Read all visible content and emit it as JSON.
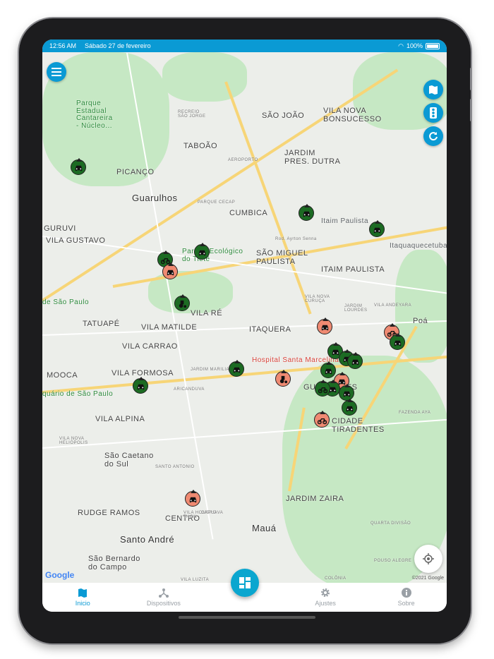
{
  "status_bar": {
    "time": "12:56 AM",
    "date": "Sábado 27 de fevereiro",
    "battery": "100%"
  },
  "map": {
    "labels": {
      "guarulhos": "Guarulhos",
      "cumbica": "CUMBICA",
      "taboao": "TABOÃO",
      "picanco": "PICANÇO",
      "sao_joao": "SÃO JOÃO",
      "vila_nova_bonsucesso": "VILA NOVA\nBONSUCESSO",
      "jardim_pres_dutra": "JARDIM\nPRES. DUTRA",
      "sao_miguel": "SÃO MIGUEL\nPAULISTA",
      "itaim_paulista": "ITAIM PAULISTA",
      "itaim_paulista_small": "Itaim Paulista",
      "itaquaquecetuba": "Itaquaquecetuba",
      "vila_re": "VILA RÉ",
      "vila_matilde": "VILA MATILDE",
      "tatuape": "TATUAPÉ",
      "vila_carrao": "VILA CARRAO",
      "mooca": "MOOCA",
      "vila_formosa": "VILA FORMOSA",
      "itaquera": "ITAQUERA",
      "hospital": "Hospital Santa Marcelina",
      "guaianases": "GUAIANASES",
      "cidade_tiradentes": "CIDADE\nTIRADENTES",
      "vila_alpina": "VILA ALPINA",
      "sao_caetano": "São Caetano\ndo Sul",
      "rudge_ramos": "RUDGE RAMOS",
      "centro": "CENTRO",
      "santo_andre": "Santo André",
      "sao_bernardo": "São Bernardo\ndo Campo",
      "jardim_zaira": "JARDIM ZAIRA",
      "maua": "Mauá",
      "poa": "Poá",
      "parque_ecologico": "Parque Ecológico\ndo Tietê",
      "parque_cantareira": "Parque\nEstadual\nCantareira\n- Núcleo...",
      "vila_gustavo": "VILA GUSTAVO",
      "guruvi": "GURUVI",
      "de_sao_paulo": "de São Paulo",
      "aquario": "quário de São Paulo",
      "aeroporto": "AEROPORTO",
      "parque_cecap": "PARQUE CECAP",
      "vila_luzita": "VILA LUZITA",
      "colonia": "COLÔNIA",
      "rod_ayrton": "Rod. Ayrton Senna",
      "vila_nova_curuca": "VILA NOVA\nCURUÇA",
      "jardim_lourdes": "JARDIM\nLOURDES",
      "vila_andeyara": "VILA ANDEYARA",
      "santo_antonio": "SANTO ANTONIO",
      "vila_homero": "VILA HOMERO\nTHON",
      "capuava": "CAPUAVA",
      "jardim_marilia": "JARDIM MARILIA",
      "aricanduva": "ARICANDUVA",
      "quarta_divisao": "QUARTA DIVISÃO",
      "fazenda_aya": "FAZENDA AYA",
      "pouso_alegre": "POUSO ALEGRE",
      "recreio": "RECREIO\nSÃO JORGE",
      "vila_nova_heliopolis": "VILA NOVA\nHELIÓPOLIS"
    },
    "google_logo": "Google",
    "copyright": "©2021 Google",
    "markers": [
      {
        "status": "online",
        "icon": "car-icon"
      },
      {
        "status": "online",
        "icon": "bike-icon"
      },
      {
        "status": "offline",
        "icon": "car-icon"
      },
      {
        "status": "online",
        "icon": "car-icon"
      },
      {
        "status": "online",
        "icon": "car-icon"
      },
      {
        "status": "online",
        "icon": "tractor-icon"
      },
      {
        "status": "online",
        "icon": "car-icon"
      },
      {
        "status": "online",
        "icon": "car-icon"
      },
      {
        "status": "online",
        "icon": "car-icon"
      },
      {
        "status": "offline",
        "icon": "tractor-icon"
      },
      {
        "status": "offline",
        "icon": "car-icon"
      },
      {
        "status": "offline",
        "icon": "bike-icon"
      },
      {
        "status": "online",
        "icon": "car-icon"
      },
      {
        "status": "online",
        "icon": "car-icon"
      },
      {
        "status": "online",
        "icon": "car-icon"
      },
      {
        "status": "online",
        "icon": "car-icon"
      },
      {
        "status": "online",
        "icon": "car-icon"
      },
      {
        "status": "offline",
        "icon": "car-icon"
      },
      {
        "status": "online",
        "icon": "car-icon"
      },
      {
        "status": "online",
        "icon": "bike-icon"
      },
      {
        "status": "online",
        "icon": "car-icon"
      },
      {
        "status": "online",
        "icon": "car-icon"
      },
      {
        "status": "offline",
        "icon": "bike-icon"
      },
      {
        "status": "offline",
        "icon": "car-icon"
      }
    ]
  },
  "tabs": [
    {
      "label": "Inicio"
    },
    {
      "label": "Dispositivos"
    },
    {
      "label": "Ajustes"
    },
    {
      "label": "Sobre"
    }
  ],
  "colors": {
    "accent": "#0a9ad4",
    "online": "#1c6b23",
    "offline": "#ef8a72"
  }
}
